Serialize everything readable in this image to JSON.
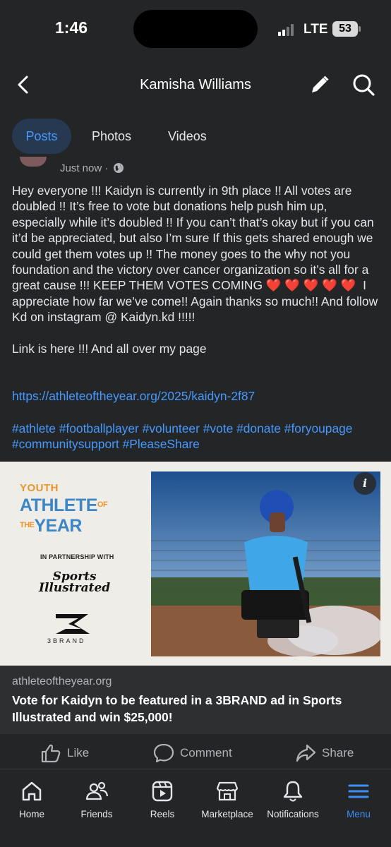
{
  "status_bar": {
    "time": "1:46",
    "network": "LTE",
    "battery": "53"
  },
  "header": {
    "title": "Kamisha Williams"
  },
  "tabs": [
    {
      "label": "Posts",
      "active": true
    },
    {
      "label": "Photos",
      "active": false
    },
    {
      "label": "Videos",
      "active": false
    }
  ],
  "post": {
    "timestamp": "Just now ·",
    "text": "Hey everyone !!! Kaidyn is currently in 9th place !! All votes are doubled !! It’s free to vote but donations help push him up, especially while it’s doubled !! If you can’t that’s okay but if you can it’d be appreciated, but also I’m sure If this gets shared enough we could get them votes up !! The money goes to the why not you foundation and the victory over cancer organization so it’s all for a great cause !!! KEEP THEM VOTES COMING ❤️ ❤️ ❤️ ❤️ ❤️  I appreciate how far we’ve come!! Again thanks so much!! And follow Kd on instagram @ Kaidyn.kd !!!!!\n\nLink is here !!! And all over my page",
    "link": "https://athleteoftheyear.org/2025/kaidyn-2f87",
    "hashtags": "#athlete #footballplayer #volunteer #vote #donate #foryoupage #communitysupport #PleaseShare"
  },
  "preview_image": {
    "line1": "YOUTH",
    "line2": "ATHLETE",
    "line2_small": "OF THE",
    "line3": "YEAR",
    "partnership": "IN PARTNERSHIP WITH",
    "si_line1": "Sports",
    "si_line2": "Illustrated",
    "brand_text": "3BRAND"
  },
  "link_card": {
    "domain": "athleteoftheyear.org",
    "title": "Vote for Kaidyn to be featured in a 3BRAND ad in Sports Illustrated and win $25,000!"
  },
  "actions": {
    "like": "Like",
    "comment": "Comment",
    "share": "Share"
  },
  "nav": [
    {
      "label": "Home",
      "icon": "home-icon"
    },
    {
      "label": "Friends",
      "icon": "friends-icon"
    },
    {
      "label": "Reels",
      "icon": "reels-icon"
    },
    {
      "label": "Marketplace",
      "icon": "marketplace-icon"
    },
    {
      "label": "Notifications",
      "icon": "bell-icon"
    },
    {
      "label": "Menu",
      "icon": "menu-icon",
      "active": true
    }
  ],
  "colors": {
    "background": "#242526",
    "accent": "#4599ff",
    "active_nav": "#1877f2"
  }
}
